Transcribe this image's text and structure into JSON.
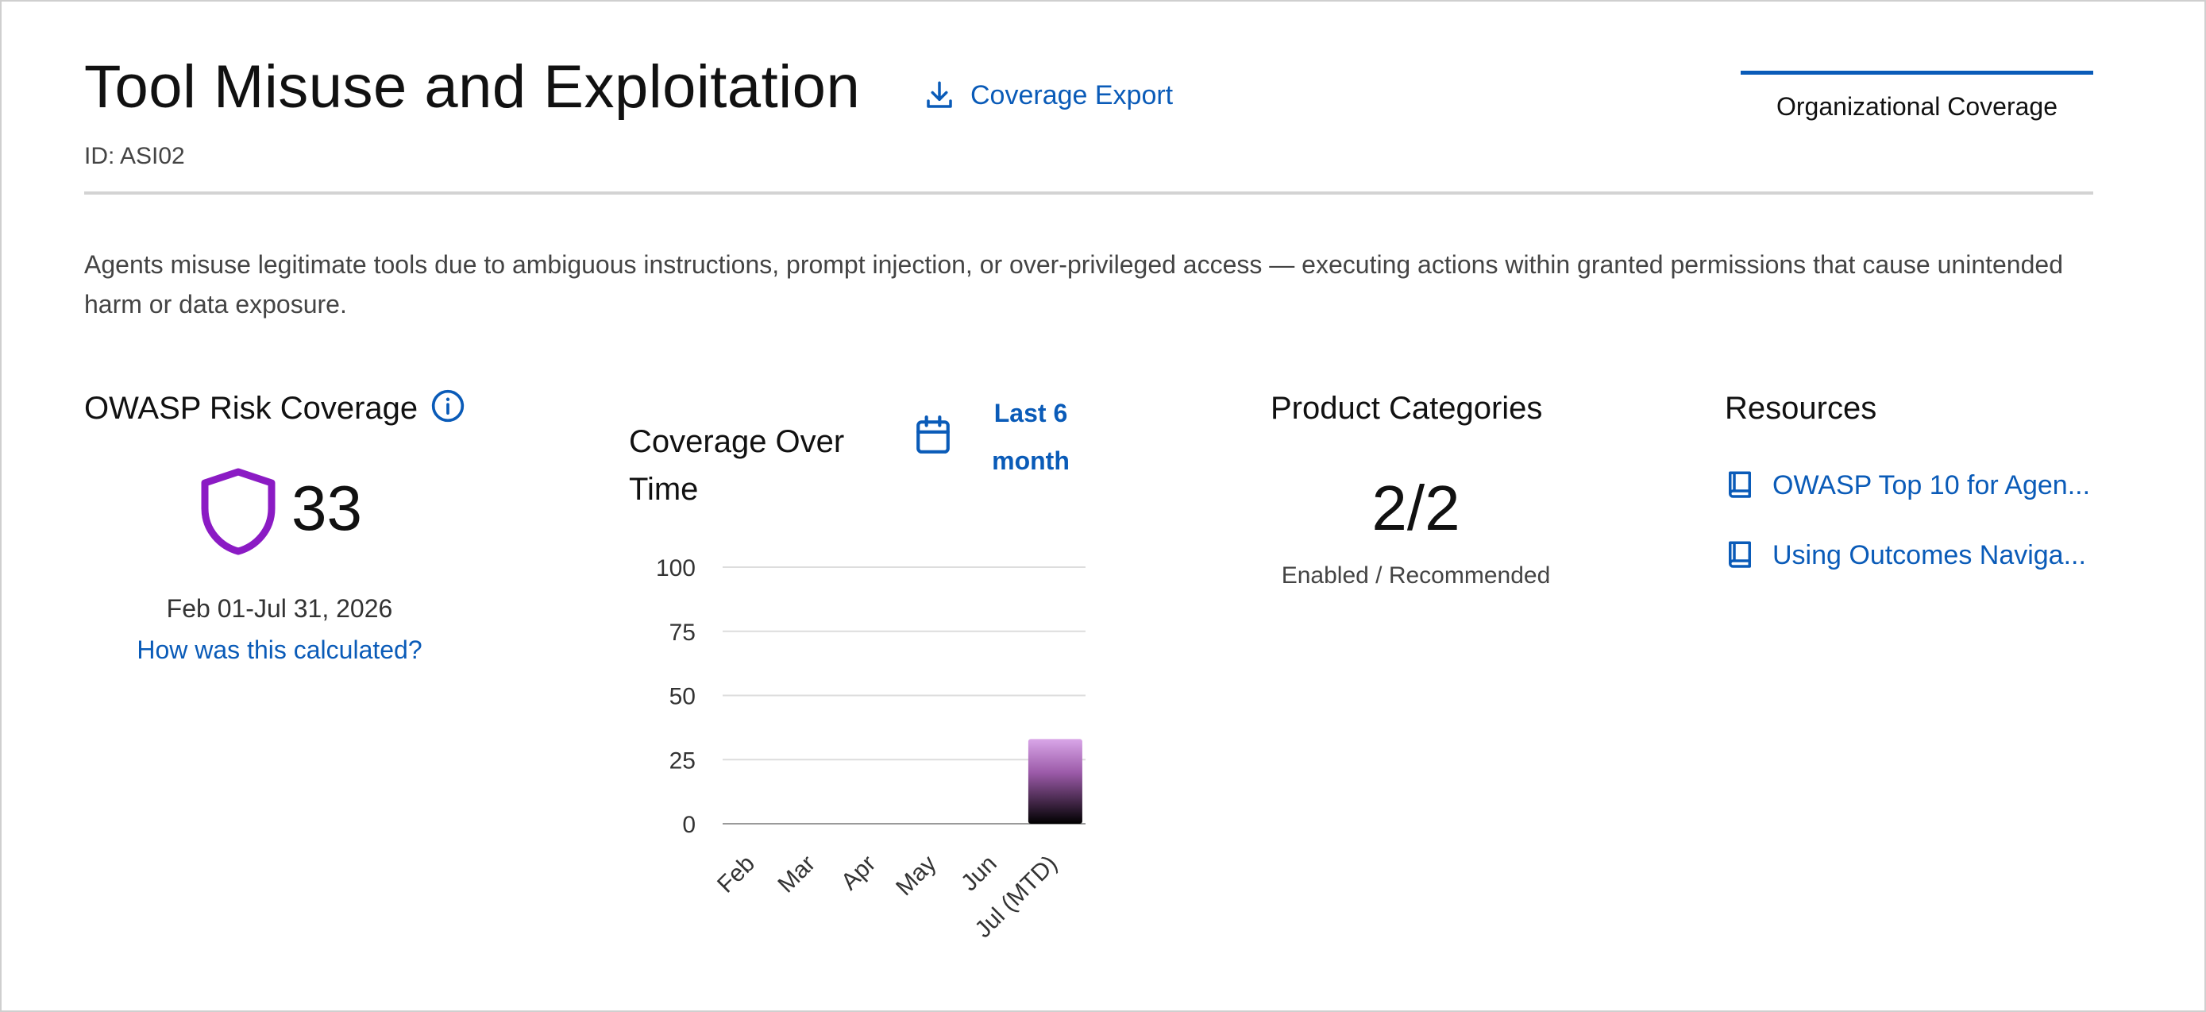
{
  "header": {
    "title": "Tool Misuse and Exploitation",
    "export_label": "Coverage Export",
    "id_line": "ID: ASI02",
    "tab_label": "Organizational Coverage"
  },
  "description": "Agents misuse legitimate tools due to ambiguous instructions, prompt injection, or over-privileged access — executing actions within granted permissions that cause unintended harm or data exposure.",
  "risk_coverage": {
    "title": "OWASP Risk Coverage",
    "value": "33",
    "date_range": "Feb 01-Jul 31, 2026",
    "calc_link": "How was this calculated?",
    "shield_color": "#8b1bc4"
  },
  "coverage_over_time": {
    "title": "Coverage Over Time",
    "range_label": "Last 6 month"
  },
  "chart_data": {
    "type": "bar",
    "categories": [
      "Feb",
      "Mar",
      "Apr",
      "May",
      "Jun",
      "Jul (MTD)"
    ],
    "values": [
      0,
      0,
      0,
      0,
      0,
      33
    ],
    "yticks": [
      0,
      25,
      50,
      75,
      100
    ],
    "ylim": [
      0,
      100
    ],
    "grid": true,
    "bar_gradient": [
      "#d9a6e8",
      "#000000"
    ]
  },
  "product_categories": {
    "title": "Product Categories",
    "value": "2/2",
    "sublabel": "Enabled / Recommended"
  },
  "resources": {
    "title": "Resources",
    "items": [
      {
        "label": "OWASP Top 10 for Agen...",
        "icon": "book-icon"
      },
      {
        "label": "Using Outcomes Naviga...",
        "icon": "book-icon"
      }
    ]
  },
  "colors": {
    "link": "#0a5bb8",
    "accent_purple": "#8b1bc4",
    "divider": "#d3d3d3"
  }
}
